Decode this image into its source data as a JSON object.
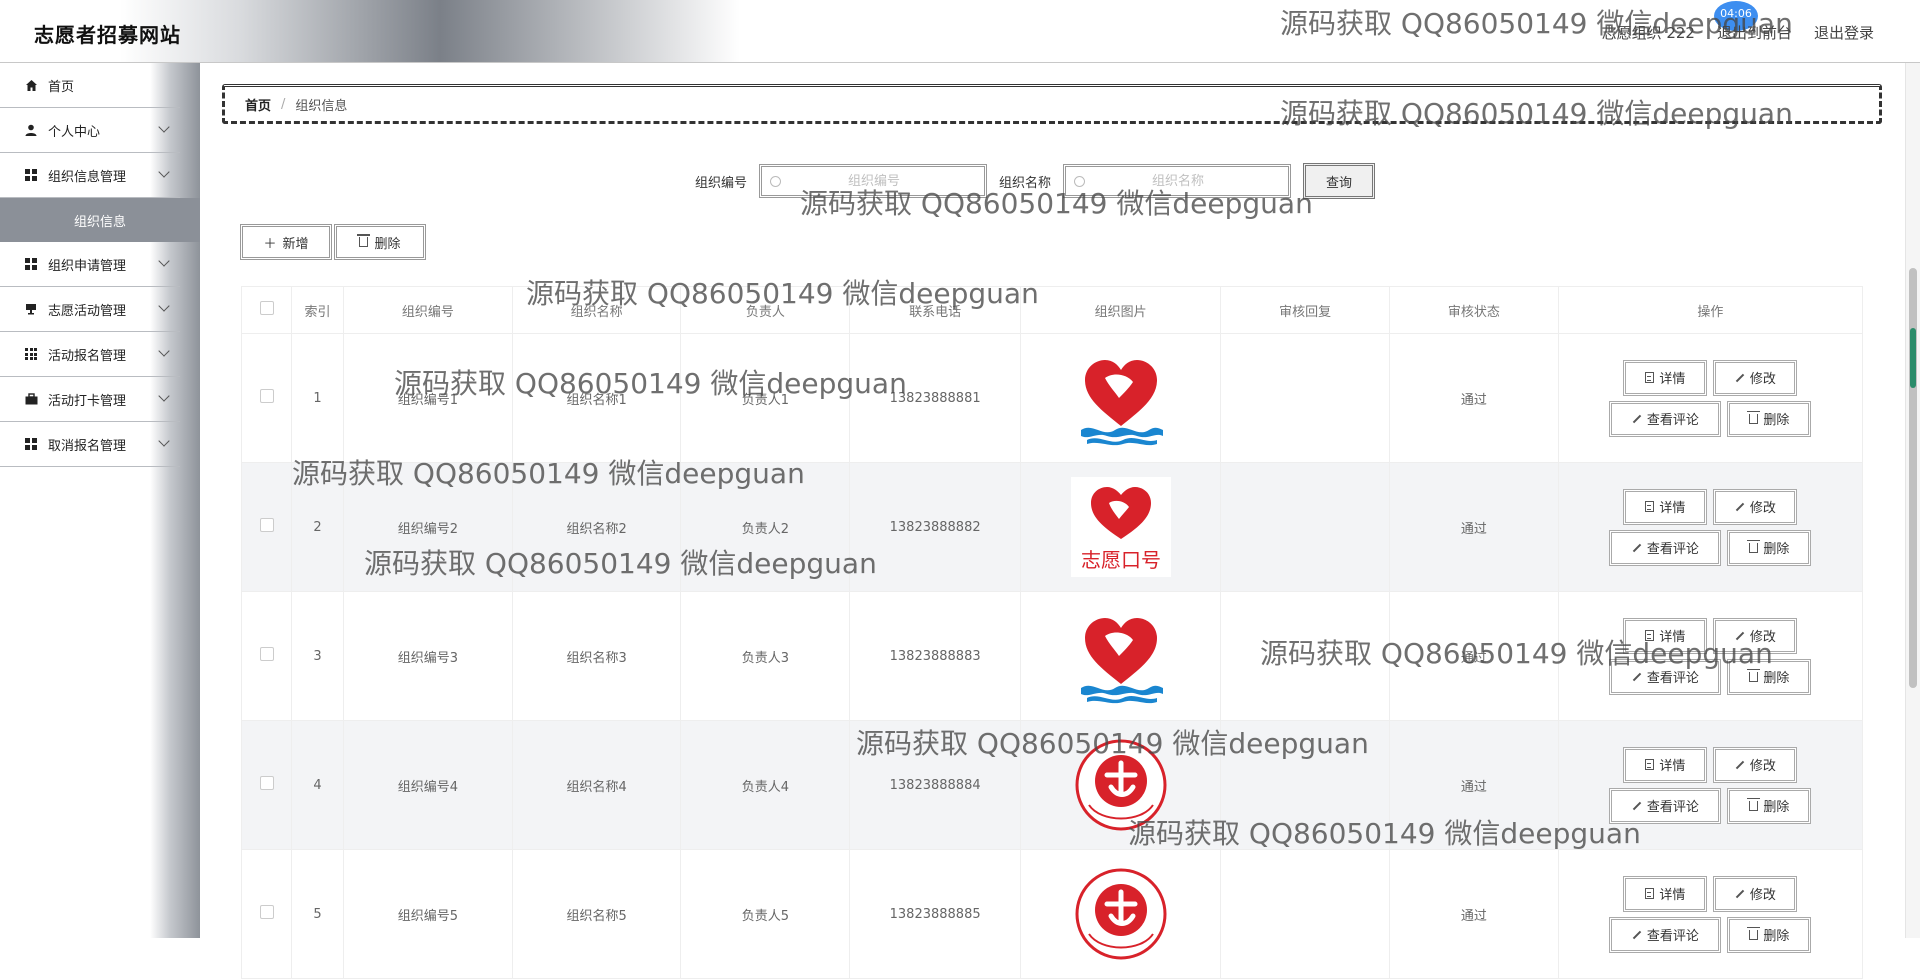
{
  "header": {
    "site_title": "志愿者招募网站",
    "user_label": "志愿组织 222",
    "back_label": "退出到前台",
    "logout_label": "退出登录",
    "badge_time": "04:06"
  },
  "sidebar": {
    "items": [
      {
        "label": "首页",
        "icon": "home-icon"
      },
      {
        "label": "个人中心",
        "icon": "user-icon"
      },
      {
        "label": "组织信息管理",
        "icon": "grid-icon"
      },
      {
        "label": "组织申请管理",
        "icon": "grid-icon"
      },
      {
        "label": "志愿活动管理",
        "icon": "flag-icon"
      },
      {
        "label": "活动报名管理",
        "icon": "grid9-icon"
      },
      {
        "label": "活动打卡管理",
        "icon": "briefcase-icon"
      },
      {
        "label": "取消报名管理",
        "icon": "grid-icon"
      }
    ],
    "sub_item": "组织信息"
  },
  "breadcrumb": {
    "home": "首页",
    "separator": "/",
    "current": "组织信息"
  },
  "search": {
    "code_label": "组织编号",
    "code_placeholder": "组织编号",
    "name_label": "组织名称",
    "name_placeholder": "组织名称",
    "query_label": "查询"
  },
  "actions": {
    "add_label": "新增",
    "delete_label": "删除"
  },
  "table": {
    "columns": [
      "",
      "索引",
      "组织编号",
      "组织名称",
      "负责人",
      "联系电话",
      "组织图片",
      "审核回复",
      "审核状态",
      "操作"
    ],
    "rows": [
      {
        "index": "1",
        "code": "组织编号1",
        "name": "组织名称1",
        "leader": "负责人1",
        "phone": "13823888881",
        "reply": "",
        "status": "通过",
        "image": "heart-wave-logo"
      },
      {
        "index": "2",
        "code": "组织编号2",
        "name": "组织名称2",
        "leader": "负责人2",
        "phone": "13823888882",
        "reply": "",
        "status": "通过",
        "image": "heart-text-logo"
      },
      {
        "index": "3",
        "code": "组织编号3",
        "name": "组织名称3",
        "leader": "负责人3",
        "phone": "13823888883",
        "reply": "",
        "status": "通过",
        "image": "heart-wave-logo"
      },
      {
        "index": "4",
        "code": "组织编号4",
        "name": "组织名称4",
        "leader": "负责人4",
        "phone": "13823888884",
        "reply": "",
        "status": "通过",
        "image": "volunteer-service-logo"
      },
      {
        "index": "5",
        "code": "组织编号5",
        "name": "组织名称5",
        "leader": "负责人5",
        "phone": "13823888885",
        "reply": "",
        "status": "通过",
        "image": "volunteer-service-logo"
      }
    ],
    "op_labels": {
      "detail": "详情",
      "edit": "修改",
      "comment": "查看评论",
      "remove": "删除"
    }
  },
  "watermark_text": "源码获取 QQ86050149 微信deepguan",
  "colors": {
    "logo_red": "#d8222a",
    "logo_blue": "#1a86d0",
    "badge_blue": "#3d8ef0",
    "sidebar_sub_bg": "#8b9098"
  }
}
